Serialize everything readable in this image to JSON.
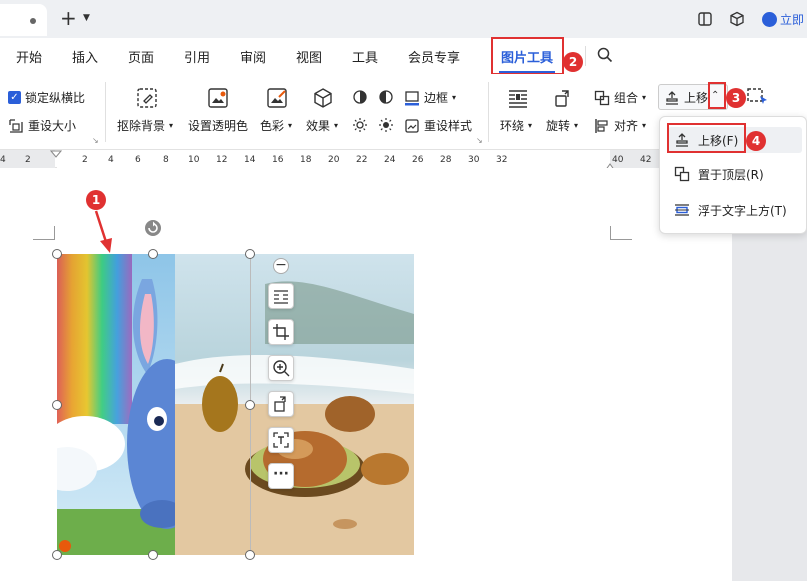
{
  "titlebar": {
    "login_label": "立即"
  },
  "menu": {
    "items": [
      "开始",
      "插入",
      "页面",
      "引用",
      "审阅",
      "视图",
      "工具",
      "会员专享"
    ],
    "active": "图片工具"
  },
  "ribbon": {
    "lock_ratio": "锁定纵横比",
    "reset_size": "重设大小",
    "remove_bg": "抠除背景",
    "set_transparent": "设置透明色",
    "color": "色彩",
    "effect": "效果",
    "border": "边框",
    "reset_style": "重设样式",
    "wrap": "环绕",
    "rotate": "旋转",
    "group": "组合",
    "align": "对齐",
    "bring_forward": "上移"
  },
  "dropdown": {
    "items": [
      "上移(F)",
      "置于顶层(R)",
      "浮于文字上方(T)"
    ]
  },
  "ruler": {
    "numbers": [
      "4",
      "2",
      "2",
      "4",
      "6",
      "8",
      "10",
      "12",
      "14",
      "16",
      "18",
      "20",
      "22",
      "24",
      "26",
      "28",
      "30",
      "32",
      "40",
      "42"
    ]
  },
  "annotations": {
    "b1": "1",
    "b2": "2",
    "b3": "3",
    "b4": "4"
  },
  "colors": {
    "accent": "#2b5fd9",
    "annotation": "#e03131"
  }
}
